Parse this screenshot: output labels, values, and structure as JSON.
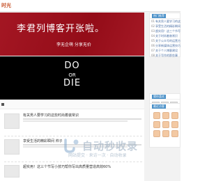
{
  "site": {
    "logo_text": "时光"
  },
  "hero": {
    "title": "李君列博客开张啦。",
    "subtitle": "李无企萌  分享无价"
  },
  "banner": {
    "line1": "DO",
    "line2": "OR",
    "line3": "DIE"
  },
  "posts": [
    {
      "title": "有关男人要学习的这些时尚着装常识"
    },
    {
      "title": "享受生活的精彩瞬间 帅子"
    },
    {
      "title": "超实用！这三个节写小技巧帮你写出高质量营造高效60%"
    }
  ],
  "sidebar": {
    "ranking_title": "热门推荐",
    "ranking": [
      {
        "num": "01",
        "text": "有关男人要学习的这些"
      },
      {
        "num": "02",
        "text": "享受生活的精彩瞬间"
      },
      {
        "num": "03",
        "text": "超实用！这三个节写小"
      },
      {
        "num": "04",
        "text": "关于时尚着装常识"
      },
      {
        "num": "05",
        "text": "关于公众号的运营方法"
      },
      {
        "num": "06",
        "text": "分享新媒体运营技巧"
      },
      {
        "num": "07",
        "text": "关于个人博客建设"
      },
      {
        "num": "08",
        "text": "关于写作的那些事"
      }
    ],
    "tags_title": "猜你喜欢",
    "visitors_title": "最近访客"
  },
  "watermark": {
    "text": "自动秒收录",
    "sub": "网站提交 · 来访一次 · 自动收录"
  },
  "colors": {
    "hero_bg": "#a00d1a",
    "banner_bg": "#000000",
    "accent": "#4a90c8"
  }
}
